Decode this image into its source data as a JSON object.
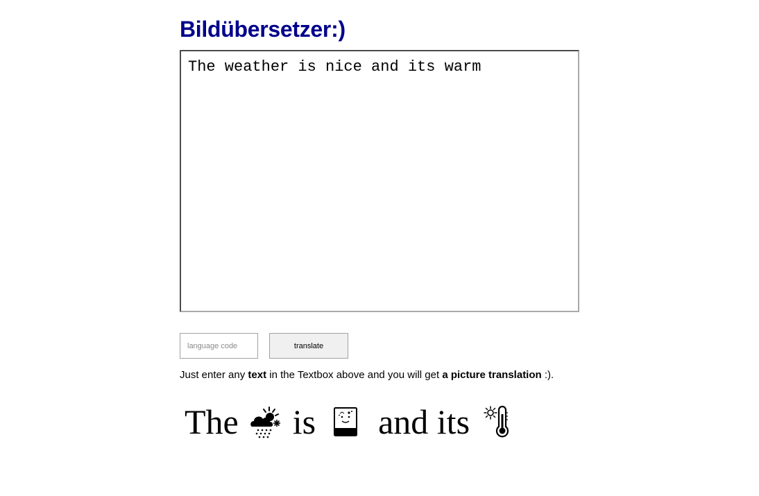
{
  "page": {
    "title": "Bildübersetzer:)"
  },
  "editor": {
    "text": "The weather is nice and its warm"
  },
  "controls": {
    "language_placeholder": "language code",
    "translate_label": "translate"
  },
  "hint": {
    "part1": "Just enter any ",
    "bold1": "text",
    "part2": " in the Textbox above and you will get ",
    "bold2": "a picture translation",
    "part3": " :)."
  },
  "result": {
    "words": [
      {
        "type": "text",
        "value": "The"
      },
      {
        "type": "icon",
        "icon": "weather-cloud-sun-rain-icon",
        "for": "weather"
      },
      {
        "type": "text",
        "value": "is"
      },
      {
        "type": "icon",
        "icon": "smiling-face-card-icon",
        "for": "nice"
      },
      {
        "type": "text",
        "value": "and its"
      },
      {
        "type": "icon",
        "icon": "thermometer-sun-icon",
        "for": "warm"
      }
    ]
  },
  "colors": {
    "title": "#00008b",
    "button_bg": "#f0f0f0"
  }
}
